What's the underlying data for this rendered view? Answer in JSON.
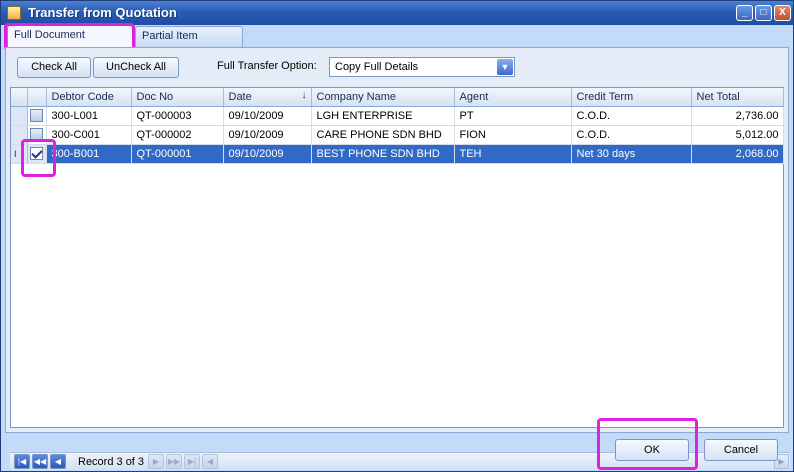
{
  "window": {
    "title": "Transfer from Quotation",
    "controls": [
      "_",
      "□",
      "X"
    ]
  },
  "tabs": [
    {
      "label": "Full Document Transfer",
      "active": true
    },
    {
      "label": "Partial Item Transfer",
      "active": false
    }
  ],
  "toolbar": {
    "check_all": "Check All",
    "uncheck_all": "UnCheck All",
    "option_label": "Full Transfer Option:",
    "option_value": "Copy Full Details"
  },
  "grid": {
    "columns": [
      "Debtor Code",
      "Doc No",
      "Date",
      "Company Name",
      "Agent",
      "Credit Term",
      "Net Total"
    ],
    "sort_column": "Date",
    "rows": [
      {
        "debtor": "300-L001",
        "doc": "QT-000003",
        "date": "09/10/2009",
        "company": "LGH ENTERPRISE",
        "agent": "PT",
        "term": "C.O.D.",
        "total": "2,736.00",
        "checked": false,
        "selected": false
      },
      {
        "debtor": "300-C001",
        "doc": "QT-000002",
        "date": "09/10/2009",
        "company": "CARE PHONE SDN BHD",
        "agent": "FION",
        "term": "C.O.D.",
        "total": "5,012.00",
        "checked": false,
        "selected": false
      },
      {
        "debtor": "300-B001",
        "doc": "QT-000001",
        "date": "09/10/2009",
        "company": "BEST PHONE SDN BHD",
        "agent": "TEH",
        "term": "Net 30 days",
        "total": "2,068.00",
        "checked": true,
        "selected": true
      }
    ]
  },
  "navigator": {
    "record_text": "Record 3 of 3"
  },
  "footer": {
    "ok": "OK",
    "cancel": "Cancel"
  },
  "colors": {
    "highlight": "#e020e0",
    "selection": "#3169c6"
  }
}
